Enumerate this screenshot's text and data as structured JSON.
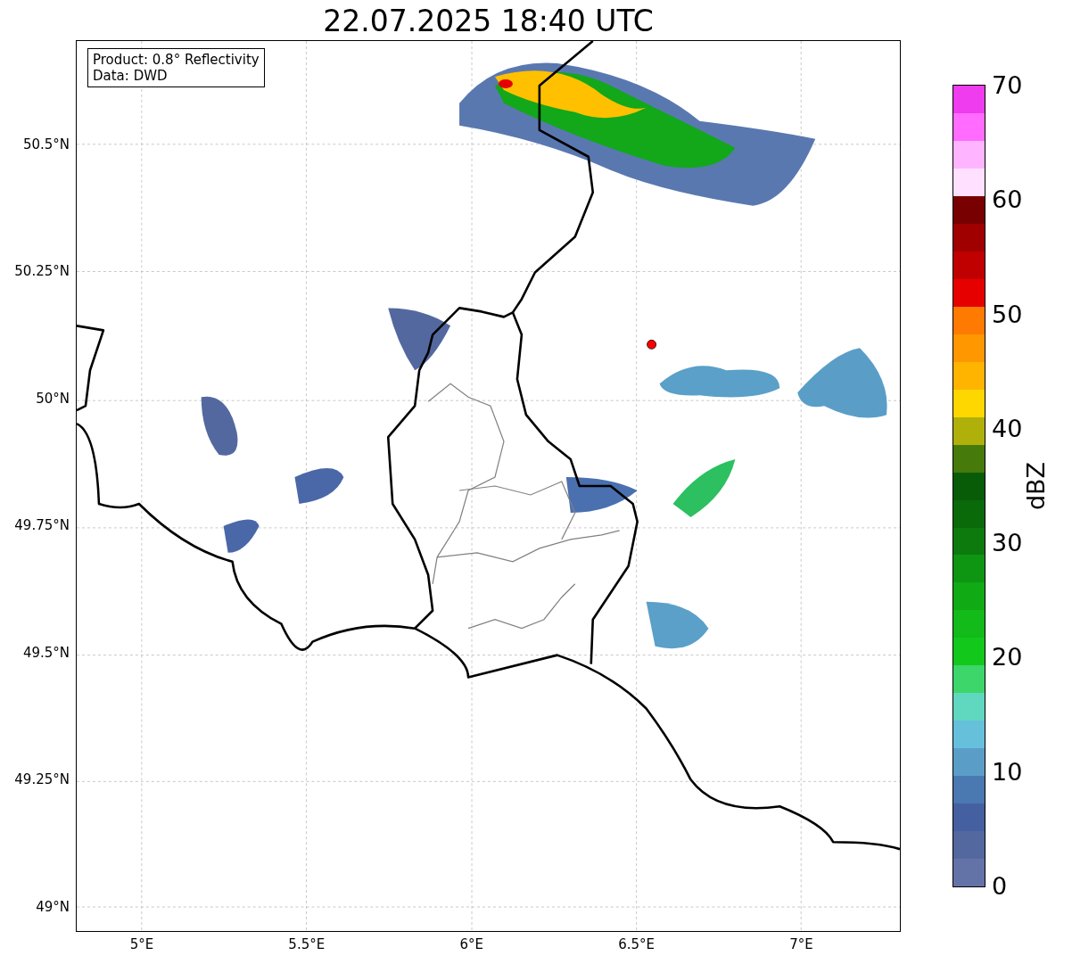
{
  "title": "22.07.2025 18:40 UTC",
  "info_box": [
    "Product: 0.8° Reflectivity",
    "Data: DWD"
  ],
  "y_ticks": [
    "50.5°N",
    "50.25°N",
    "50°N",
    "49.75°N",
    "49.5°N",
    "49.25°N",
    "49°N"
  ],
  "x_ticks": [
    "5°E",
    "5.5°E",
    "6°E",
    "6.5°E",
    "7°E"
  ],
  "colorbar": {
    "label": "dBZ",
    "ticks": [
      "70",
      "60",
      "50",
      "40",
      "30",
      "20",
      "10",
      "0"
    ],
    "bins": [
      {
        "color": "#6373a8"
      },
      {
        "color": "#5468a0"
      },
      {
        "color": "#4560a0"
      },
      {
        "color": "#4a78b0"
      },
      {
        "color": "#5a9ec8"
      },
      {
        "color": "#66c0dc"
      },
      {
        "color": "#60d8c0"
      },
      {
        "color": "#3cd66a"
      },
      {
        "color": "#12c81a"
      },
      {
        "color": "#12ba1a"
      },
      {
        "color": "#10aa14"
      },
      {
        "color": "#0e9612"
      },
      {
        "color": "#0c7a0c"
      },
      {
        "color": "#0a6a0a"
      },
      {
        "color": "#085c08"
      },
      {
        "color": "#467a0a"
      },
      {
        "color": "#b0b00a"
      },
      {
        "color": "#ffd700"
      },
      {
        "color": "#ffb400"
      },
      {
        "color": "#ff9800"
      },
      {
        "color": "#ff7a00"
      },
      {
        "color": "#e60000"
      },
      {
        "color": "#c00000"
      },
      {
        "color": "#a00000"
      },
      {
        "color": "#780000"
      },
      {
        "color": "#ffe0ff"
      },
      {
        "color": "#ffb4ff"
      },
      {
        "color": "#ff6cff"
      },
      {
        "color": "#ee3cee"
      }
    ]
  }
}
